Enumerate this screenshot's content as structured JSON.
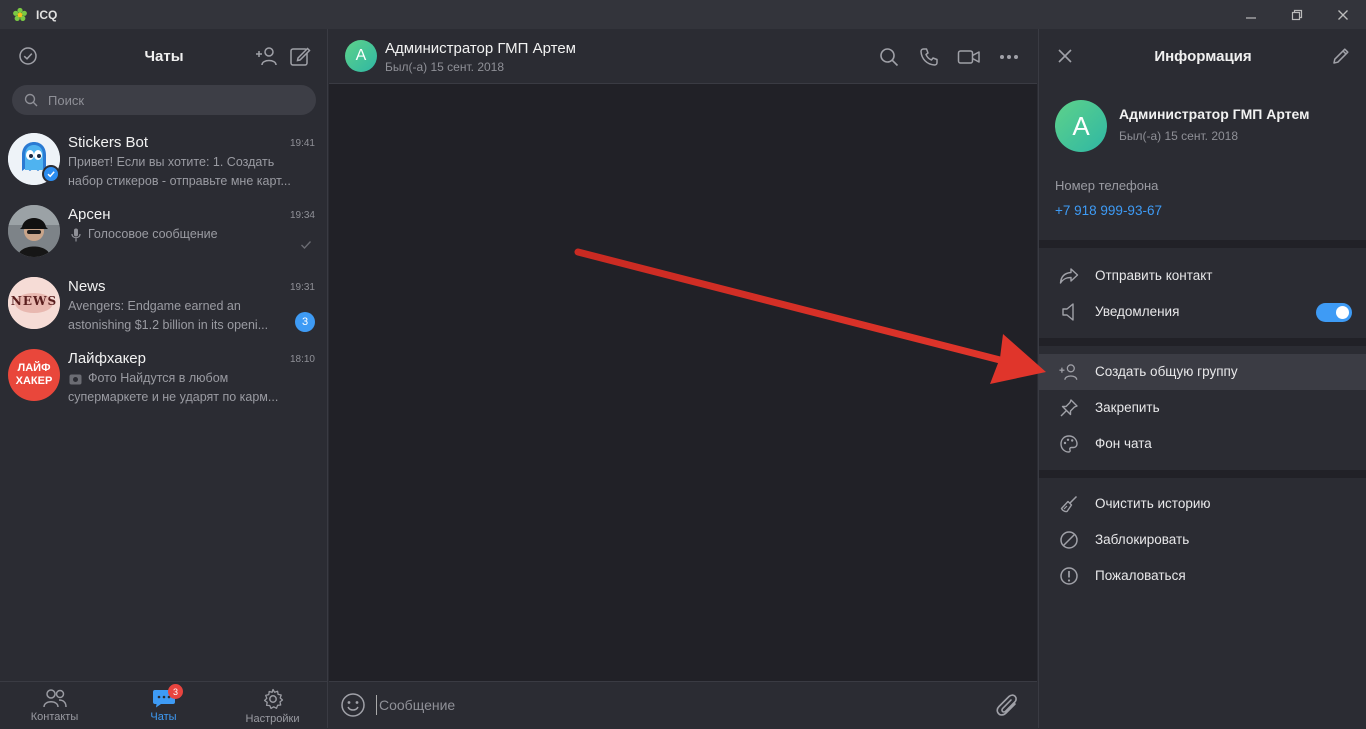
{
  "window": {
    "title": "ICQ"
  },
  "left": {
    "title": "Чаты",
    "search_placeholder": "Поиск",
    "chats": [
      {
        "name": "Stickers Bot",
        "time": "19:41",
        "line1": "Привет! Если вы хотите:  1. Создать",
        "line2": "набор стикеров - отправьте мне карт..."
      },
      {
        "name": "Арсен",
        "time": "19:34",
        "line1": "Голосовое сообщение",
        "line2": ""
      },
      {
        "name": "News",
        "time": "19:31",
        "line1": "Avengers: Endgame earned an",
        "line2": "astonishing $1.2 billion in its openi...",
        "badge": "3"
      },
      {
        "name": "Лайфхакер",
        "time": "18:10",
        "line1": "Фото Найдутся в любом",
        "line2": "супермаркете и не ударят по карм..."
      }
    ],
    "news_avatar_text": "NEWS",
    "lifehacker_avatar": [
      "ЛАЙФ",
      "ХАКЕР"
    ],
    "nav": [
      {
        "label": "Контакты"
      },
      {
        "label": "Чаты",
        "badge": "3"
      },
      {
        "label": "Настройки"
      }
    ]
  },
  "middle": {
    "avatar_letter": "А",
    "contact_name": "Администратор ГМП Артем",
    "status": "Был(-а) 15 сент. 2018",
    "message_placeholder": "Сообщение"
  },
  "right": {
    "title": "Информация",
    "avatar_letter": "А",
    "name": "Администратор ГМП Артем",
    "status": "Был(-а) 15 сент. 2018",
    "phone_label": "Номер телефона",
    "phone": "+7 918 999-93-67",
    "menu": {
      "send_contact": "Отправить контакт",
      "notifications": "Уведомления",
      "create_group": "Создать общую группу",
      "pin": "Закрепить",
      "chat_bg": "Фон чата",
      "clear_history": "Очистить историю",
      "block": "Заблокировать",
      "report": "Пожаловаться"
    }
  },
  "colors": {
    "accent": "#3e9bf5",
    "background": "#2b2c33",
    "chat_bg": "#212127",
    "arrow": "#e0352b"
  },
  "icons": [
    "icq-flower-icon",
    "minimize-icon",
    "restore-icon",
    "close-icon",
    "check-circle-icon",
    "add-contact-icon",
    "compose-icon",
    "search-icon",
    "phone-icon",
    "video-icon",
    "more-icon",
    "smile-icon",
    "attach-icon",
    "pencil-icon",
    "share-icon",
    "speaker-icon",
    "pin-icon",
    "palette-icon",
    "broom-icon",
    "block-icon",
    "report-icon"
  ]
}
